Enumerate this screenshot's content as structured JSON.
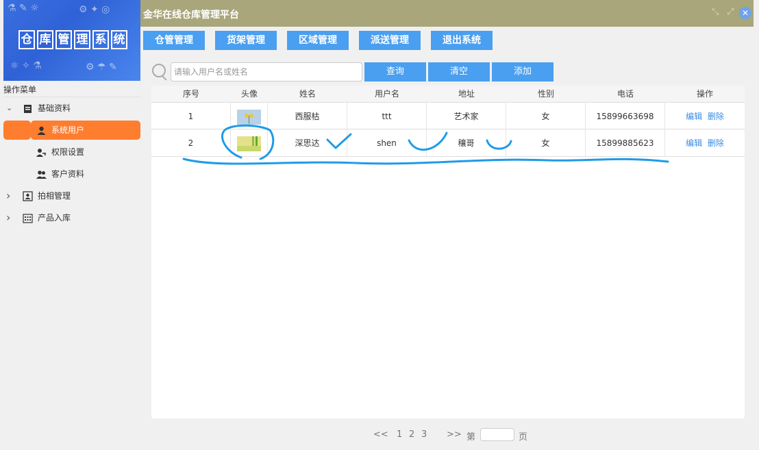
{
  "app": {
    "title": "金华在线仓库管理平台",
    "logo_text": [
      "仓",
      "库",
      "管",
      "理",
      "系",
      "统"
    ]
  },
  "nav": [
    "仓管管理",
    "货架管理",
    "区域管理",
    "派送管理",
    "退出系统"
  ],
  "sidebar": {
    "header": "操作菜单",
    "items": [
      {
        "label": "基础资料",
        "caret": "⌄",
        "icon": "clipboard-icon"
      },
      {
        "label": "系统用户",
        "icon": "user-icon",
        "active": true
      },
      {
        "label": "权限设置",
        "icon": "key-user-icon"
      },
      {
        "label": "客户资料",
        "icon": "users-icon"
      },
      {
        "label": "拍相管理",
        "caret": "›",
        "icon": "portrait-icon"
      },
      {
        "label": "产品入库",
        "caret": "›",
        "icon": "grid-icon"
      }
    ]
  },
  "search": {
    "placeholder": "请输入用户名或姓名",
    "value": ""
  },
  "actions": {
    "query": "查询",
    "clear": "清空",
    "add": "添加"
  },
  "table": {
    "columns": [
      "序号",
      "头像",
      "姓名",
      "用户名",
      "地址",
      "性别",
      "电话",
      "操作"
    ],
    "rows": [
      {
        "index": "1",
        "name": "西服枯",
        "username": "ttt",
        "address": "艺术家",
        "gender": "女",
        "phone": "15899663698",
        "edit": "编辑",
        "delete": "删除"
      },
      {
        "index": "2",
        "name": "深思达",
        "username": "shen",
        "address": "穰哥",
        "gender": "女",
        "phone": "15899885623",
        "edit": "编辑",
        "delete": "删除"
      }
    ]
  },
  "pagination": {
    "prev": "<<",
    "pages": [
      "1",
      "2",
      "3"
    ],
    "next": ">>",
    "before_input": "第",
    "after_input": "页",
    "input_value": ""
  },
  "colors": {
    "topbar": "#a8a67a",
    "button": "#4a9ff0",
    "active_menu": "#ff7d2e",
    "link": "#3a8de6",
    "annotation": "#1e9be8"
  }
}
